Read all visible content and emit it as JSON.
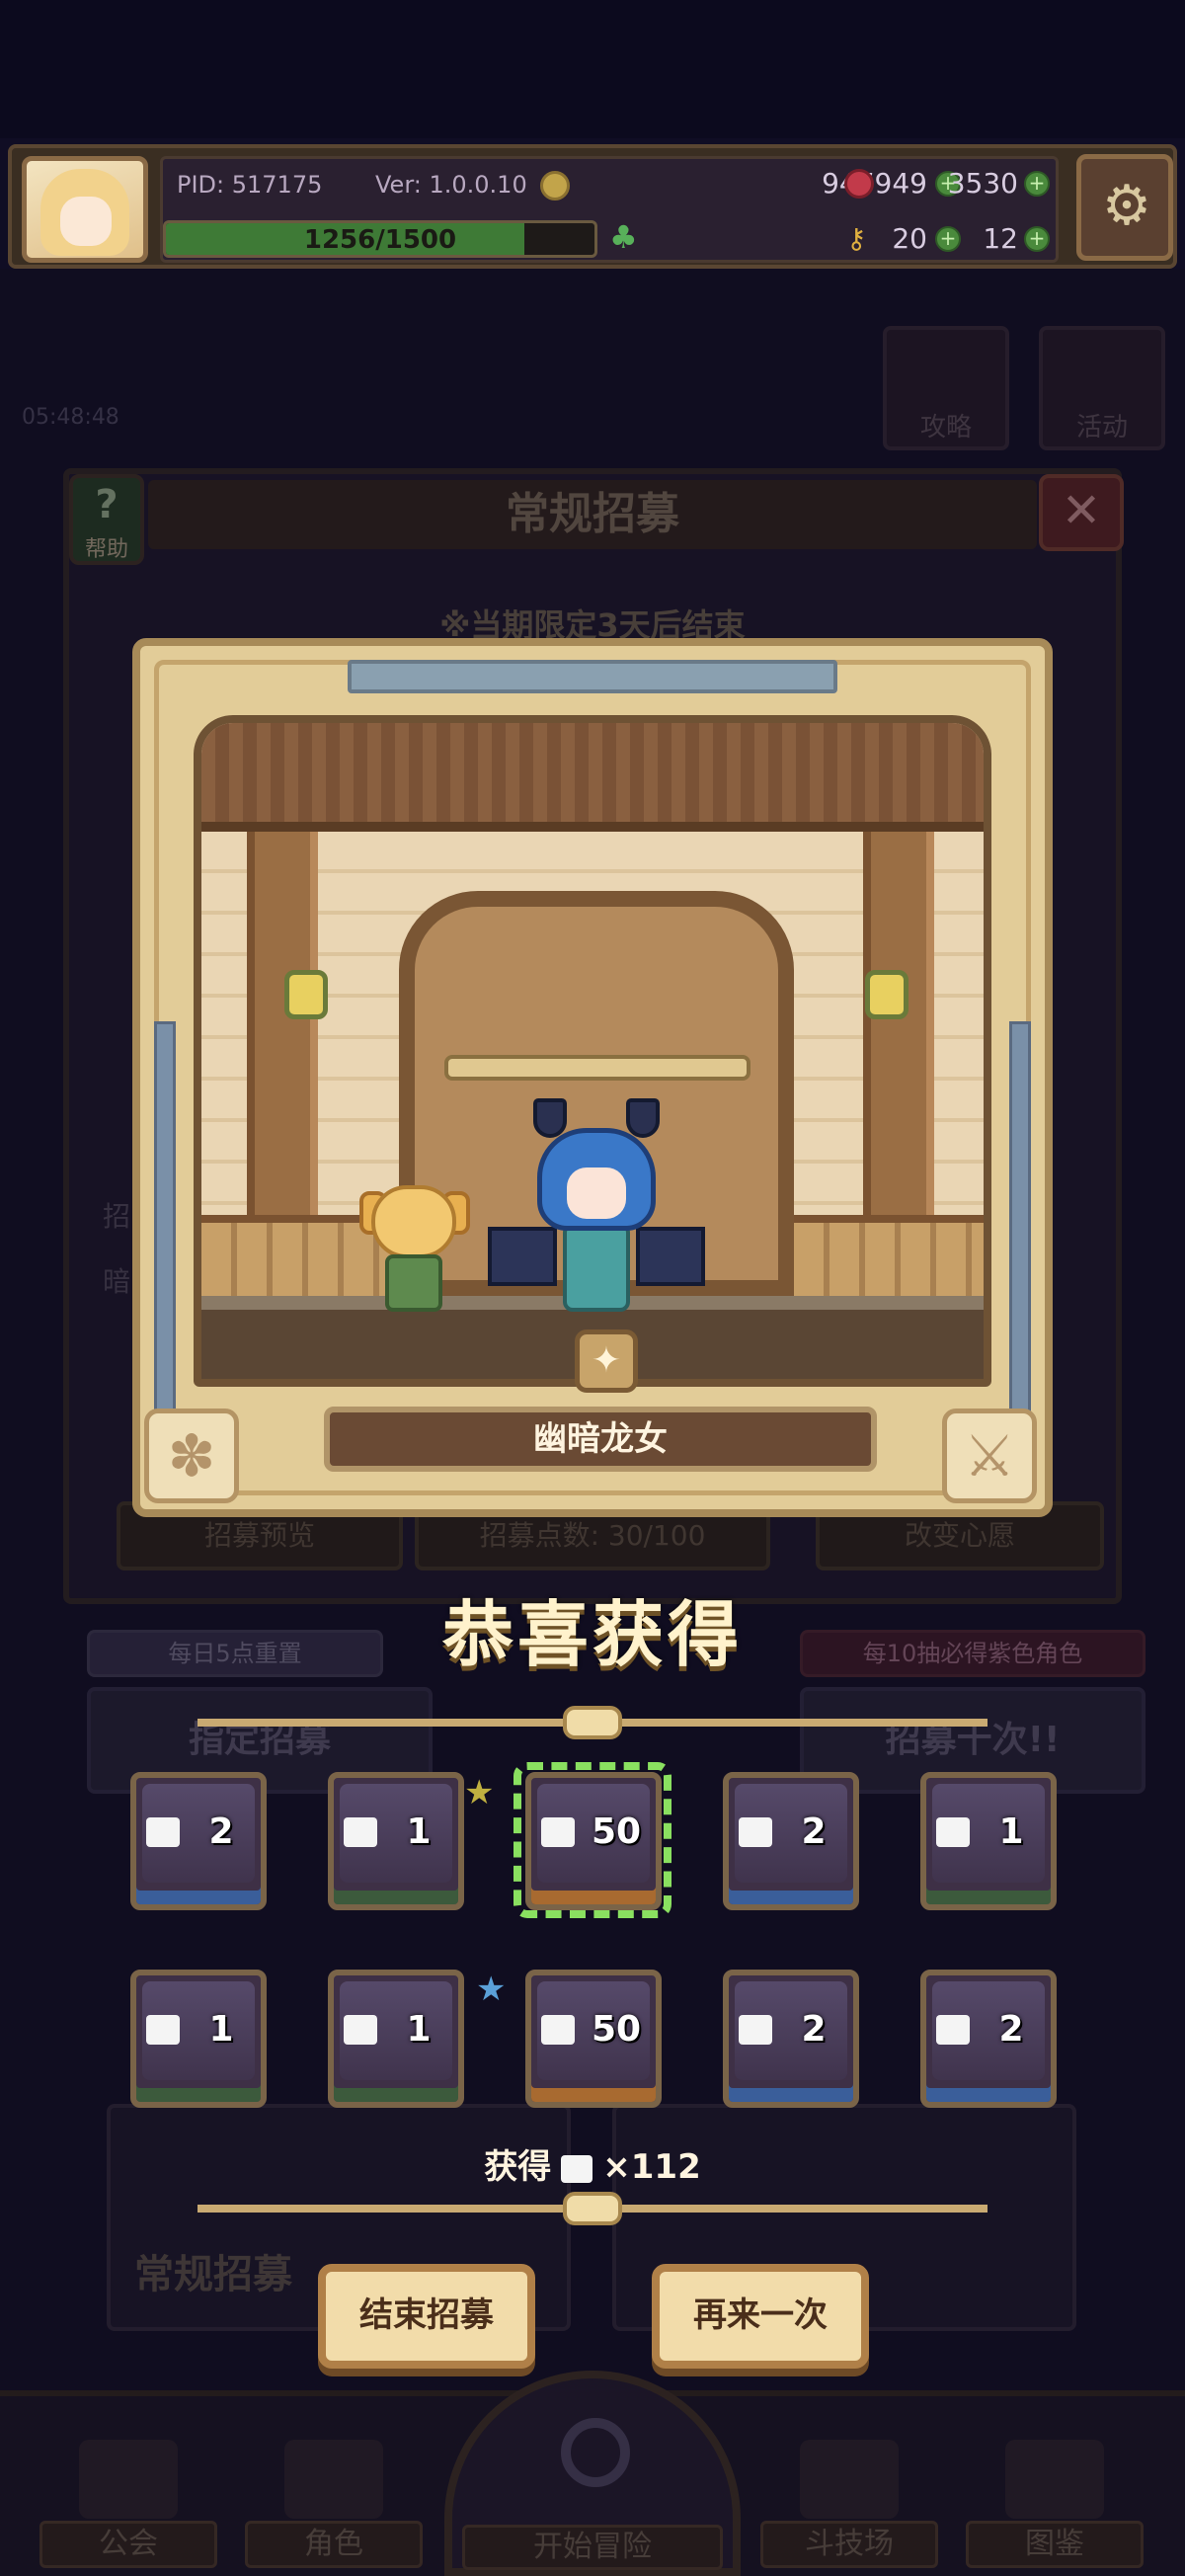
{
  "status": {
    "pid": "PID: 517175",
    "version": "Ver: 1.0.0.10",
    "gold": "947949",
    "gems": "3530",
    "clovers": "20",
    "keys": "12",
    "exp_text": "1256/1500",
    "exp_progress": 0.8373
  },
  "background": {
    "timer": "05:48:48",
    "strategy": "攻略",
    "event": "活动",
    "panel_title": "常规招募",
    "help": "帮助",
    "limited_text": "※当期限定3天后结束",
    "side_1": "招",
    "side_2": "暗",
    "preview": "招募预览",
    "points": "招募点数: 30/100",
    "wish": "改变心愿",
    "reset_tag": "每日5点重置",
    "guarantee_tag": "每10抽必得紫色角色",
    "designate": "指定招募",
    "ten_pull": "招募十次!!",
    "bottom_label": "常规招募"
  },
  "nav": {
    "guild": "公会",
    "roles": "角色",
    "adventure": "开始冒险",
    "arena": "斗技场",
    "codex": "图鉴"
  },
  "result": {
    "character_name": "幽暗龙女",
    "congrats": "恭喜获得",
    "items": [
      {
        "qty": "2",
        "rarity": "blue"
      },
      {
        "qty": "1",
        "rarity": "green"
      },
      {
        "qty": "50",
        "rarity": "orange"
      },
      {
        "qty": "2",
        "rarity": "blue"
      },
      {
        "qty": "1",
        "rarity": "green"
      },
      {
        "qty": "1",
        "rarity": "green"
      },
      {
        "qty": "1",
        "rarity": "green"
      },
      {
        "qty": "50",
        "rarity": "orange"
      },
      {
        "qty": "2",
        "rarity": "blue"
      },
      {
        "qty": "2",
        "rarity": "blue"
      }
    ],
    "obtain_prefix": "获得",
    "obtain_total": "×112",
    "end_button": "结束招募",
    "again_button": "再来一次"
  }
}
